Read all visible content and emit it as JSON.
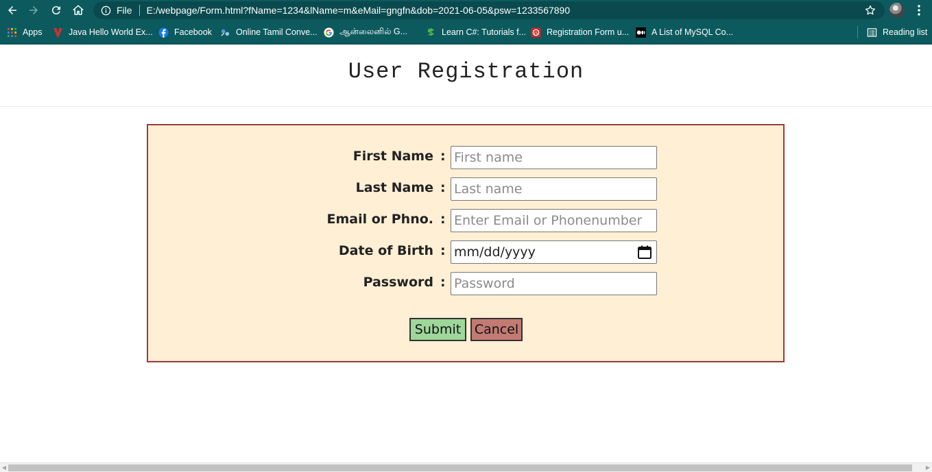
{
  "browser": {
    "url_scheme": "File",
    "url": "E:/webpage/Form.html?fName=1234&lName=m&eMail=gngfn&dob=2021-06-05&psw=1233567890",
    "theme_color": "#0c5a5e"
  },
  "bookmarks": [
    {
      "label": "Apps",
      "icon": "apps-grid-icon"
    },
    {
      "label": "Java Hello World Ex...",
      "icon": "java-v-icon"
    },
    {
      "label": "Facebook",
      "icon": "facebook-icon"
    },
    {
      "label": "Online Tamil Conve...",
      "icon": "tamil-converter-icon"
    },
    {
      "label": "ஆன்லைனில் G...",
      "icon": "google-icon"
    },
    {
      "label": "Learn C#: Tutorials f...",
      "icon": "learn-csharp-icon"
    },
    {
      "label": "Registration Form u...",
      "icon": "registration-form-icon"
    },
    {
      "label": "A List of MySQL Co...",
      "icon": "medium-icon"
    }
  ],
  "reading_list": "Reading list",
  "page": {
    "title": "User Registration"
  },
  "form": {
    "fields": [
      {
        "label": "First Name",
        "placeholder": "First name"
      },
      {
        "label": "Last Name",
        "placeholder": "Last name"
      },
      {
        "label": "Email or Phno.",
        "placeholder": "Enter Email or Phonenumber"
      },
      {
        "label": "Date of Birth",
        "value": "mm/dd/yyyy"
      },
      {
        "label": "Password",
        "placeholder": "Password"
      }
    ],
    "colon": ":",
    "submit_label": "Submit",
    "cancel_label": "Cancel",
    "colors": {
      "background": "#ffefd5",
      "border": "#a0393b",
      "submit": "#9ed79a",
      "cancel": "#c27a73"
    }
  }
}
